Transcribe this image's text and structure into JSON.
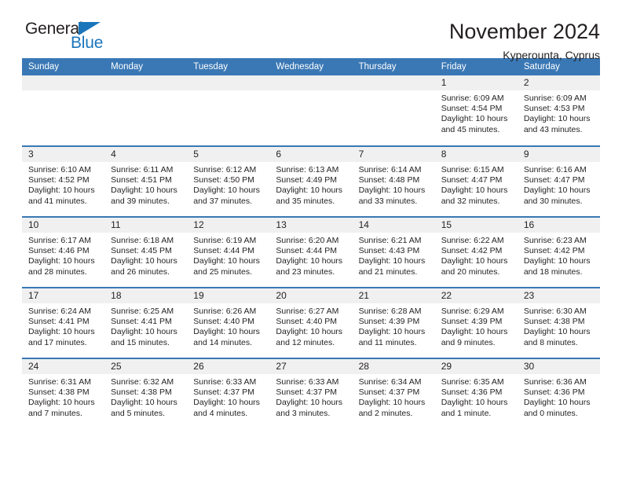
{
  "logo": {
    "word_one": "General",
    "word_two": "Blue",
    "triangle_icon": "blue-triangle-icon",
    "brand_color": "#1b75bb"
  },
  "header": {
    "title": "November 2024",
    "location": "Kyperounta, Cyprus"
  },
  "theme": {
    "header_blue": "#3a78b5",
    "daynum_band": "#f0f0f0",
    "text": "#231f20"
  },
  "calendar": {
    "weekday_headers": [
      "Sunday",
      "Monday",
      "Tuesday",
      "Wednesday",
      "Thursday",
      "Friday",
      "Saturday"
    ],
    "labels": {
      "sunrise": "Sunrise:",
      "sunset": "Sunset:",
      "daylight": "Daylight:"
    },
    "weeks": [
      [
        {
          "day": "",
          "empty": true
        },
        {
          "day": "",
          "empty": true
        },
        {
          "day": "",
          "empty": true
        },
        {
          "day": "",
          "empty": true
        },
        {
          "day": "",
          "empty": true
        },
        {
          "day": "1",
          "sunrise": "Sunrise: 6:09 AM",
          "sunset": "Sunset: 4:54 PM",
          "daylight": "Daylight: 10 hours and 45 minutes."
        },
        {
          "day": "2",
          "sunrise": "Sunrise: 6:09 AM",
          "sunset": "Sunset: 4:53 PM",
          "daylight": "Daylight: 10 hours and 43 minutes."
        }
      ],
      [
        {
          "day": "3",
          "sunrise": "Sunrise: 6:10 AM",
          "sunset": "Sunset: 4:52 PM",
          "daylight": "Daylight: 10 hours and 41 minutes."
        },
        {
          "day": "4",
          "sunrise": "Sunrise: 6:11 AM",
          "sunset": "Sunset: 4:51 PM",
          "daylight": "Daylight: 10 hours and 39 minutes."
        },
        {
          "day": "5",
          "sunrise": "Sunrise: 6:12 AM",
          "sunset": "Sunset: 4:50 PM",
          "daylight": "Daylight: 10 hours and 37 minutes."
        },
        {
          "day": "6",
          "sunrise": "Sunrise: 6:13 AM",
          "sunset": "Sunset: 4:49 PM",
          "daylight": "Daylight: 10 hours and 35 minutes."
        },
        {
          "day": "7",
          "sunrise": "Sunrise: 6:14 AM",
          "sunset": "Sunset: 4:48 PM",
          "daylight": "Daylight: 10 hours and 33 minutes."
        },
        {
          "day": "8",
          "sunrise": "Sunrise: 6:15 AM",
          "sunset": "Sunset: 4:47 PM",
          "daylight": "Daylight: 10 hours and 32 minutes."
        },
        {
          "day": "9",
          "sunrise": "Sunrise: 6:16 AM",
          "sunset": "Sunset: 4:47 PM",
          "daylight": "Daylight: 10 hours and 30 minutes."
        }
      ],
      [
        {
          "day": "10",
          "sunrise": "Sunrise: 6:17 AM",
          "sunset": "Sunset: 4:46 PM",
          "daylight": "Daylight: 10 hours and 28 minutes."
        },
        {
          "day": "11",
          "sunrise": "Sunrise: 6:18 AM",
          "sunset": "Sunset: 4:45 PM",
          "daylight": "Daylight: 10 hours and 26 minutes."
        },
        {
          "day": "12",
          "sunrise": "Sunrise: 6:19 AM",
          "sunset": "Sunset: 4:44 PM",
          "daylight": "Daylight: 10 hours and 25 minutes."
        },
        {
          "day": "13",
          "sunrise": "Sunrise: 6:20 AM",
          "sunset": "Sunset: 4:44 PM",
          "daylight": "Daylight: 10 hours and 23 minutes."
        },
        {
          "day": "14",
          "sunrise": "Sunrise: 6:21 AM",
          "sunset": "Sunset: 4:43 PM",
          "daylight": "Daylight: 10 hours and 21 minutes."
        },
        {
          "day": "15",
          "sunrise": "Sunrise: 6:22 AM",
          "sunset": "Sunset: 4:42 PM",
          "daylight": "Daylight: 10 hours and 20 minutes."
        },
        {
          "day": "16",
          "sunrise": "Sunrise: 6:23 AM",
          "sunset": "Sunset: 4:42 PM",
          "daylight": "Daylight: 10 hours and 18 minutes."
        }
      ],
      [
        {
          "day": "17",
          "sunrise": "Sunrise: 6:24 AM",
          "sunset": "Sunset: 4:41 PM",
          "daylight": "Daylight: 10 hours and 17 minutes."
        },
        {
          "day": "18",
          "sunrise": "Sunrise: 6:25 AM",
          "sunset": "Sunset: 4:41 PM",
          "daylight": "Daylight: 10 hours and 15 minutes."
        },
        {
          "day": "19",
          "sunrise": "Sunrise: 6:26 AM",
          "sunset": "Sunset: 4:40 PM",
          "daylight": "Daylight: 10 hours and 14 minutes."
        },
        {
          "day": "20",
          "sunrise": "Sunrise: 6:27 AM",
          "sunset": "Sunset: 4:40 PM",
          "daylight": "Daylight: 10 hours and 12 minutes."
        },
        {
          "day": "21",
          "sunrise": "Sunrise: 6:28 AM",
          "sunset": "Sunset: 4:39 PM",
          "daylight": "Daylight: 10 hours and 11 minutes."
        },
        {
          "day": "22",
          "sunrise": "Sunrise: 6:29 AM",
          "sunset": "Sunset: 4:39 PM",
          "daylight": "Daylight: 10 hours and 9 minutes."
        },
        {
          "day": "23",
          "sunrise": "Sunrise: 6:30 AM",
          "sunset": "Sunset: 4:38 PM",
          "daylight": "Daylight: 10 hours and 8 minutes."
        }
      ],
      [
        {
          "day": "24",
          "sunrise": "Sunrise: 6:31 AM",
          "sunset": "Sunset: 4:38 PM",
          "daylight": "Daylight: 10 hours and 7 minutes."
        },
        {
          "day": "25",
          "sunrise": "Sunrise: 6:32 AM",
          "sunset": "Sunset: 4:38 PM",
          "daylight": "Daylight: 10 hours and 5 minutes."
        },
        {
          "day": "26",
          "sunrise": "Sunrise: 6:33 AM",
          "sunset": "Sunset: 4:37 PM",
          "daylight": "Daylight: 10 hours and 4 minutes."
        },
        {
          "day": "27",
          "sunrise": "Sunrise: 6:33 AM",
          "sunset": "Sunset: 4:37 PM",
          "daylight": "Daylight: 10 hours and 3 minutes."
        },
        {
          "day": "28",
          "sunrise": "Sunrise: 6:34 AM",
          "sunset": "Sunset: 4:37 PM",
          "daylight": "Daylight: 10 hours and 2 minutes."
        },
        {
          "day": "29",
          "sunrise": "Sunrise: 6:35 AM",
          "sunset": "Sunset: 4:36 PM",
          "daylight": "Daylight: 10 hours and 1 minute."
        },
        {
          "day": "30",
          "sunrise": "Sunrise: 6:36 AM",
          "sunset": "Sunset: 4:36 PM",
          "daylight": "Daylight: 10 hours and 0 minutes."
        }
      ]
    ]
  }
}
